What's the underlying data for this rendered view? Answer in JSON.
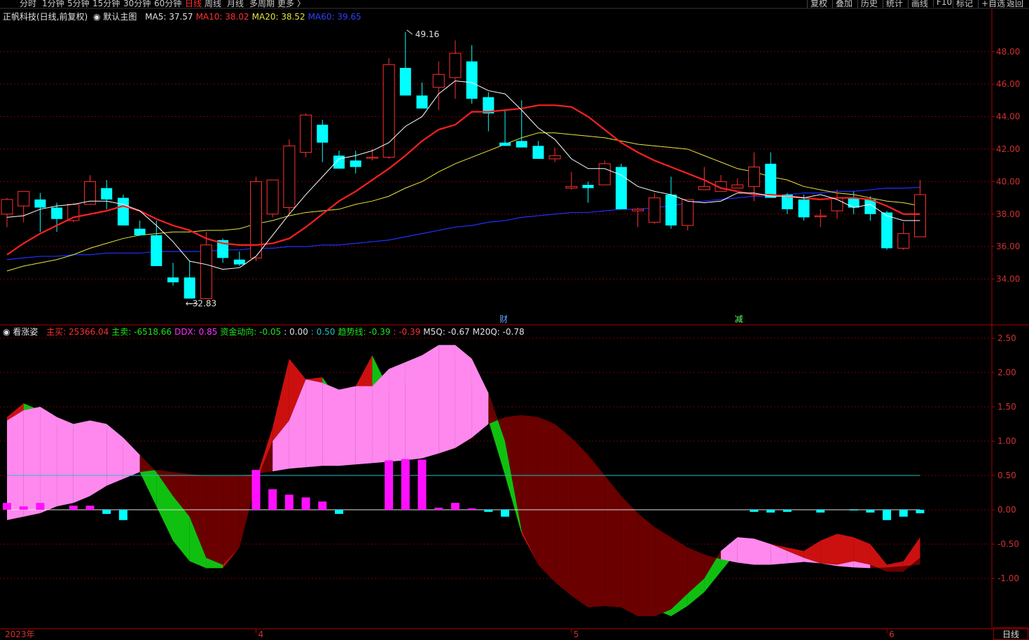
{
  "toolbar": {
    "periods": [
      "分时",
      "1分钟",
      "5分钟",
      "15分钟",
      "30分钟",
      "60分钟",
      "日线",
      "周线",
      "月线",
      "多周期",
      "更多 〉"
    ],
    "active_period": "日线",
    "right_buttons": [
      "复权",
      "叠加",
      "历史",
      "统计",
      "画线",
      "F10",
      "标记",
      "+自选",
      "返回"
    ]
  },
  "main_info": {
    "stock": "正帆科技(日线,前复权)",
    "template": "默认主图",
    "ma": [
      {
        "label": "MA5: 37.57",
        "color": "#e0e0e0"
      },
      {
        "label": "MA10: 38.02",
        "color": "#ff3030"
      },
      {
        "label": "MA20: 38.52",
        "color": "#e0e040"
      },
      {
        "label": "MA60: 39.65",
        "color": "#3040ff"
      }
    ]
  },
  "sub_info": {
    "name": "看涨姿",
    "items": [
      {
        "label": "主买:",
        "value": "25366.04",
        "color": "#ff3030"
      },
      {
        "label": "主卖:",
        "value": "-6518.66",
        "color": "#20e020"
      },
      {
        "label": "DDX:",
        "value": "0.85",
        "color": "#ff30ff"
      },
      {
        "label": "资金动向:",
        "value": "-0.05",
        "color": "#20e020"
      },
      {
        "label": ":",
        "value": "0.00",
        "color": "#e0e0e0"
      },
      {
        "label": ":",
        "value": "0.50",
        "color": "#20c0c0"
      },
      {
        "label": "趋势线:",
        "value": "-0.39",
        "color": "#20e020"
      },
      {
        "label": ":",
        "value": "-0.39",
        "color": "#ff3030"
      },
      {
        "label": "M5Q:",
        "value": "-0.67",
        "color": "#e0e0e0"
      },
      {
        "label": "M20Q:",
        "value": "-0.78",
        "color": "#e0e0e0"
      }
    ]
  },
  "colors": {
    "up": "#ff3030",
    "down": "#00ffff",
    "ma5": "#ffffff",
    "ma10": "#ff2020",
    "ma20": "#e8e840",
    "ma60": "#2030ff",
    "grid": "#7a0000",
    "axis": "#b00000",
    "pink": "#ff88ee",
    "darkred": "#6a0000",
    "red": "#cc1010",
    "green": "#10c010",
    "bar_pos": "#ff10ff",
    "bar_neg": "#00ffff",
    "ref_line": "#20c0c0"
  },
  "annotations": {
    "high": "49.16",
    "low": "32.83",
    "event1": "财",
    "event2": "减"
  },
  "x_axis": [
    {
      "label": "2023年",
      "i": 0
    },
    {
      "label": "4",
      "i": 15
    },
    {
      "label": "5",
      "i": 34
    },
    {
      "label": "6",
      "i": 53
    }
  ],
  "bottom_label": "日线",
  "chart_data": [
    {
      "type": "candlestick",
      "title": "正帆科技(日线,前复权)",
      "y_ticks": [
        "34.00",
        "36.00",
        "38.00",
        "40.00",
        "42.00",
        "44.00",
        "46.00",
        "48.00"
      ],
      "ylim": [
        32.3,
        49.8
      ],
      "candles": [
        [
          38.0,
          39.0,
          37.2,
          38.9
        ],
        [
          38.5,
          39.4,
          37.5,
          39.4
        ],
        [
          38.9,
          39.3,
          36.9,
          38.4
        ],
        [
          38.4,
          38.7,
          36.9,
          37.7
        ],
        [
          37.6,
          38.7,
          37.5,
          38.6
        ],
        [
          38.6,
          40.4,
          38.6,
          40.0
        ],
        [
          39.6,
          40.1,
          38.3,
          38.9
        ],
        [
          39.0,
          39.2,
          37.4,
          37.3
        ],
        [
          37.1,
          37.6,
          36.8,
          36.7
        ],
        [
          36.7,
          37.6,
          34.9,
          34.8
        ],
        [
          34.1,
          35.0,
          33.6,
          33.8
        ],
        [
          34.1,
          35.1,
          32.8,
          32.8
        ],
        [
          32.8,
          36.9,
          32.8,
          36.1
        ],
        [
          36.4,
          36.5,
          35.0,
          35.3
        ],
        [
          35.2,
          35.7,
          34.8,
          34.9
        ],
        [
          35.3,
          40.3,
          35.1,
          40.0
        ],
        [
          38.0,
          40.0,
          37.8,
          40.1
        ],
        [
          38.4,
          42.6,
          38.0,
          42.2
        ],
        [
          41.8,
          44.2,
          41.5,
          44.1
        ],
        [
          43.5,
          43.8,
          41.2,
          42.4
        ],
        [
          41.6,
          41.9,
          40.8,
          40.8
        ],
        [
          41.3,
          41.9,
          40.5,
          40.9
        ],
        [
          41.5,
          42.0,
          41.3,
          41.5
        ],
        [
          41.5,
          47.6,
          41.4,
          47.2
        ],
        [
          47.0,
          49.2,
          45.5,
          45.3
        ],
        [
          45.3,
          46.1,
          44.5,
          44.5
        ],
        [
          45.8,
          47.4,
          44.4,
          46.6
        ],
        [
          46.4,
          48.7,
          45.1,
          47.9
        ],
        [
          47.4,
          48.4,
          44.8,
          45.1
        ],
        [
          45.2,
          45.5,
          43.1,
          44.2
        ],
        [
          42.4,
          44.4,
          42.2,
          42.2
        ],
        [
          42.5,
          45.0,
          42.2,
          42.1
        ],
        [
          42.2,
          42.5,
          41.4,
          41.4
        ],
        [
          41.4,
          42.1,
          41.2,
          41.6
        ],
        [
          39.6,
          40.6,
          39.5,
          39.7
        ],
        [
          39.8,
          40.0,
          38.7,
          39.6
        ],
        [
          39.8,
          41.3,
          39.8,
          41.1
        ],
        [
          40.9,
          41.1,
          38.4,
          38.3
        ],
        [
          38.2,
          38.4,
          37.2,
          38.3
        ],
        [
          37.5,
          39.3,
          37.4,
          39.0
        ],
        [
          39.2,
          40.3,
          37.1,
          37.3
        ],
        [
          37.3,
          38.9,
          37.0,
          38.9
        ],
        [
          39.5,
          40.9,
          39.5,
          39.7
        ],
        [
          39.4,
          40.4,
          39.4,
          40.0
        ],
        [
          39.6,
          40.2,
          39.6,
          39.8
        ],
        [
          39.7,
          41.8,
          38.8,
          40.9
        ],
        [
          41.1,
          41.8,
          39.0,
          39.0
        ],
        [
          39.2,
          39.3,
          38.0,
          38.3
        ],
        [
          38.9,
          39.2,
          37.6,
          37.8
        ],
        [
          37.9,
          38.3,
          37.2,
          37.9
        ],
        [
          38.2,
          39.5,
          37.7,
          39.0
        ],
        [
          39.0,
          39.4,
          38.0,
          38.4
        ],
        [
          38.9,
          39.1,
          37.6,
          38.0
        ],
        [
          38.1,
          38.2,
          35.8,
          35.9
        ],
        [
          35.9,
          37.5,
          35.8,
          36.8
        ],
        [
          36.6,
          40.1,
          36.6,
          39.2
        ]
      ],
      "ma5": [
        37.8,
        37.9,
        38.3,
        38.5,
        38.6,
        38.8,
        38.8,
        38.6,
        38.2,
        37.3,
        36.3,
        35.1,
        34.9,
        34.6,
        34.7,
        35.4,
        36.7,
        38.0,
        39.2,
        40.3,
        41.4,
        41.6,
        41.9,
        42.4,
        43.4,
        44.0,
        45.4,
        46.2,
        46.1,
        45.6,
        45.4,
        44.4,
        43.3,
        42.6,
        41.4,
        40.8,
        40.8,
        40.4,
        39.7,
        39.4,
        39.2,
        38.8,
        38.7,
        38.8,
        39.3,
        39.3,
        39.1,
        39.1,
        39.0,
        39.2,
        38.9,
        38.4,
        38.6,
        37.9,
        37.6,
        37.6
      ],
      "ma10": [
        35.5,
        36.2,
        36.8,
        37.3,
        37.8,
        38.0,
        38.2,
        38.5,
        38.2,
        37.7,
        37.3,
        37.0,
        36.5,
        36.2,
        36.1,
        36.1,
        36.2,
        36.5,
        37.2,
        38.0,
        38.8,
        39.4,
        40.1,
        40.8,
        41.6,
        42.5,
        43.2,
        43.5,
        44.3,
        44.3,
        44.4,
        44.5,
        44.7,
        44.7,
        44.6,
        44.0,
        43.2,
        42.4,
        41.8,
        41.3,
        40.9,
        40.5,
        40.1,
        39.6,
        39.4,
        39.2,
        39.2,
        39.1,
        39.0,
        38.9,
        39.0,
        39.0,
        38.9,
        38.5,
        38.0,
        38.0
      ],
      "ma20": [
        34.5,
        34.8,
        35.0,
        35.2,
        35.5,
        35.9,
        36.2,
        36.5,
        36.7,
        36.8,
        36.9,
        36.9,
        37.0,
        37.0,
        37.1,
        37.4,
        37.6,
        37.9,
        38.1,
        38.2,
        38.3,
        38.6,
        38.8,
        39.1,
        39.6,
        40.0,
        40.6,
        41.1,
        41.5,
        41.9,
        42.3,
        42.7,
        43.0,
        43.0,
        42.9,
        42.8,
        42.7,
        42.5,
        42.3,
        42.2,
        42.1,
        42.0,
        41.6,
        41.2,
        40.8,
        40.6,
        40.3,
        40.1,
        39.7,
        39.5,
        39.3,
        39.2,
        39.0,
        38.8,
        38.7,
        38.5
      ],
      "ma60": [
        35.2,
        35.3,
        35.4,
        35.4,
        35.5,
        35.5,
        35.6,
        35.6,
        35.6,
        35.7,
        35.7,
        35.7,
        35.7,
        35.8,
        35.8,
        35.9,
        35.9,
        36.0,
        36.0,
        36.1,
        36.1,
        36.2,
        36.3,
        36.4,
        36.6,
        36.8,
        37.0,
        37.2,
        37.3,
        37.5,
        37.6,
        37.8,
        37.9,
        38.0,
        38.1,
        38.1,
        38.2,
        38.3,
        38.3,
        38.4,
        38.5,
        38.7,
        38.8,
        38.9,
        39.0,
        39.1,
        39.1,
        39.2,
        39.3,
        39.3,
        39.4,
        39.4,
        39.5,
        39.6,
        39.6,
        39.65
      ]
    },
    {
      "type": "area",
      "title": "看涨姿",
      "y_ticks": [
        "-1.00",
        "-0.50",
        "0.00",
        "0.50",
        "1.00",
        "1.50",
        "2.00",
        "2.50"
      ],
      "ylim": [
        -1.55,
        2.55
      ],
      "ddx_bars": [
        0.1,
        0.05,
        0.1,
        0.0,
        0.06,
        0.06,
        -0.06,
        -0.15,
        0.0,
        0.0,
        0.0,
        0.0,
        0.0,
        0.0,
        0.0,
        0.58,
        0.3,
        0.22,
        0.18,
        0.12,
        -0.06,
        0.0,
        0.0,
        0.72,
        0.74,
        0.73,
        0.03,
        0.1,
        0.02,
        -0.03,
        -0.1,
        0.0,
        0.0,
        0.0,
        0.0,
        0.0,
        0.0,
        0.0,
        0.0,
        0.0,
        0.0,
        0.0,
        0.0,
        0.0,
        0.0,
        -0.03,
        -0.04,
        -0.03,
        0.0,
        -0.04,
        0.0,
        -0.01,
        -0.04,
        -0.15,
        -0.1,
        -0.05
      ],
      "line_a": [
        1.35,
        1.55,
        1.45,
        1.22,
        1.18,
        1.25,
        1.15,
        0.95,
        0.55,
        0.05,
        -0.45,
        -0.75,
        -0.85,
        -0.85,
        -0.55,
        0.45,
        1.2,
        2.2,
        1.9,
        1.93,
        1.58,
        1.8,
        2.25,
        1.75,
        1.85,
        2.15,
        2.4,
        2.2,
        1.8,
        1.3,
        0.5,
        -0.35,
        -0.8,
        -0.9,
        -1.0,
        -1.1,
        -1.25,
        -1.3,
        -1.45,
        -1.45,
        -1.55,
        -1.4,
        -1.2,
        -0.9,
        -0.6,
        -0.42,
        -0.5,
        -0.55,
        -0.6,
        -0.45,
        -0.35,
        -0.4,
        -0.5,
        -0.8,
        -0.75,
        -0.4
      ],
      "line_b": [
        1.3,
        1.45,
        1.5,
        1.35,
        1.25,
        1.3,
        1.25,
        1.05,
        0.8,
        0.55,
        0.2,
        -0.1,
        -0.7,
        -0.8,
        -0.55,
        0.4,
        1.0,
        1.3,
        1.9,
        1.85,
        1.75,
        1.8,
        1.8,
        2.05,
        2.15,
        2.25,
        2.4,
        2.4,
        2.2,
        1.7,
        1.0,
        -0.3,
        -0.8,
        -1.05,
        -1.25,
        -1.42,
        -1.4,
        -1.42,
        -1.55,
        -1.55,
        -1.45,
        -1.22,
        -1.0,
        -0.6,
        -0.4,
        -0.42,
        -0.5,
        -0.6,
        -0.7,
        -0.78,
        -0.8,
        -0.75,
        -0.8,
        -0.9,
        -0.9,
        -0.7
      ],
      "baseline": [
        -0.15,
        -0.1,
        -0.05,
        0.05,
        0.1,
        0.2,
        0.35,
        0.45,
        0.55,
        0.58,
        0.55,
        0.52,
        0.5,
        0.5,
        0.5,
        0.52,
        0.56,
        0.6,
        0.62,
        0.64,
        0.64,
        0.66,
        0.68,
        0.7,
        0.72,
        0.75,
        0.82,
        0.9,
        1.05,
        1.25,
        1.35,
        1.38,
        1.35,
        1.25,
        1.05,
        0.8,
        0.5,
        0.2,
        -0.05,
        -0.25,
        -0.4,
        -0.55,
        -0.65,
        -0.72,
        -0.77,
        -0.8,
        -0.8,
        -0.78,
        -0.76,
        -0.78,
        -0.82,
        -0.84,
        -0.85,
        -0.84,
        -0.82,
        -0.8
      ]
    }
  ]
}
